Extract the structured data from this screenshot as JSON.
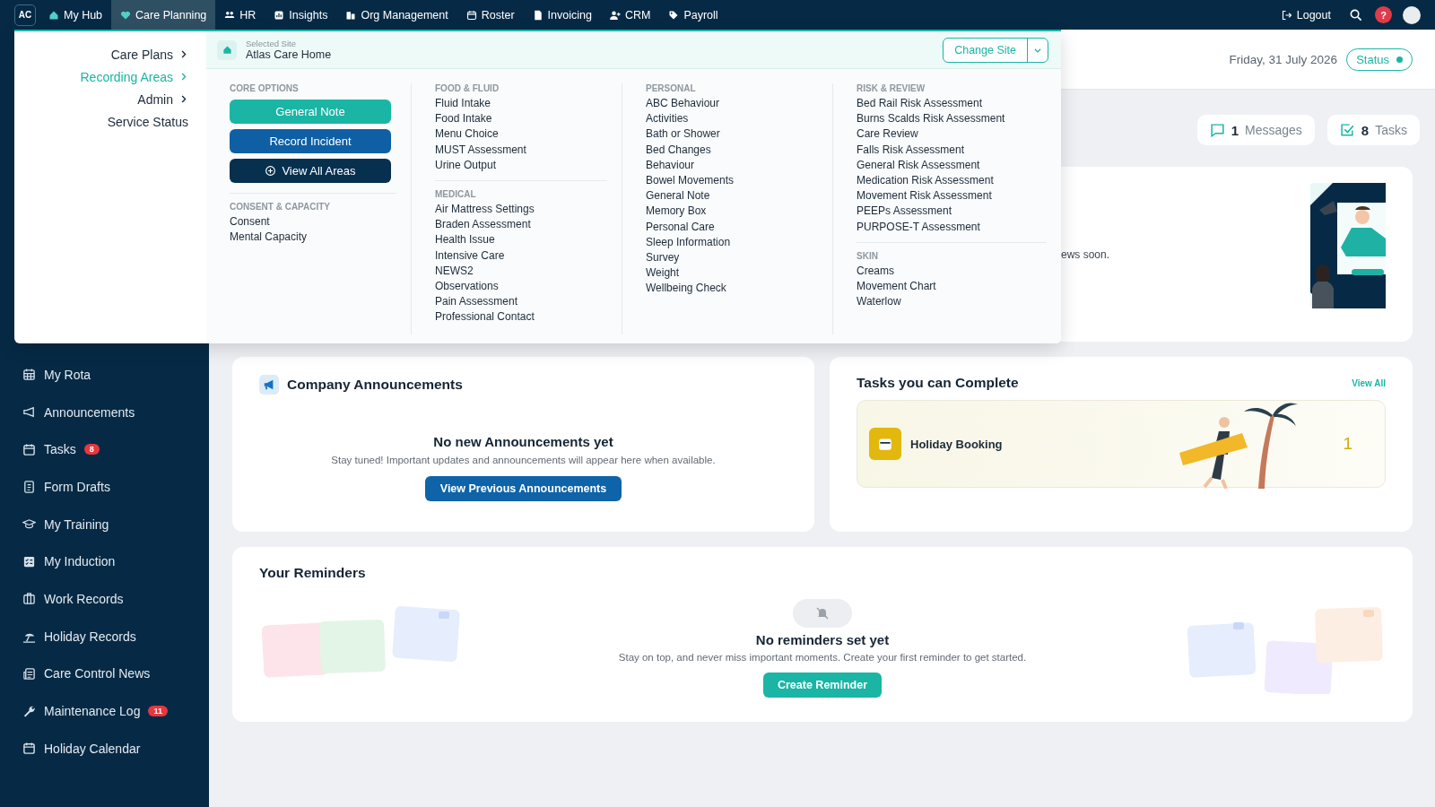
{
  "topbar": {
    "logo": "AC",
    "nav": [
      {
        "label": "My Hub",
        "selected": false
      },
      {
        "label": "Care Planning",
        "selected": true
      },
      {
        "label": "HR",
        "selected": false
      },
      {
        "label": "Insights",
        "selected": false
      },
      {
        "label": "Org Management",
        "selected": false
      },
      {
        "label": "Roster",
        "selected": false
      },
      {
        "label": "Invoicing",
        "selected": false
      },
      {
        "label": "CRM",
        "selected": false
      },
      {
        "label": "Payroll",
        "selected": false
      }
    ],
    "logout": "Logout",
    "help": "?"
  },
  "header": {
    "date": "Friday, 31 July 2026",
    "status": "Status"
  },
  "summary": [
    {
      "count": "1",
      "label": "Messages"
    },
    {
      "count": "8",
      "label": "Tasks"
    }
  ],
  "news_card": {
    "text": "ews soon."
  },
  "sidebar": {
    "items": [
      {
        "label": "My Rota"
      },
      {
        "label": "Announcements"
      },
      {
        "label": "Tasks",
        "badge": "8"
      },
      {
        "label": "Form Drafts"
      },
      {
        "label": "My Training"
      },
      {
        "label": "My Induction"
      },
      {
        "label": "Work Records"
      },
      {
        "label": "Holiday Records"
      },
      {
        "label": "Care Control News"
      },
      {
        "label": "Maintenance Log",
        "badge": "11"
      },
      {
        "label": "Holiday Calendar"
      }
    ]
  },
  "menu": {
    "categories": [
      {
        "label": "Care Plans",
        "selected": false,
        "submenu": true
      },
      {
        "label": "Recording Areas",
        "selected": true,
        "submenu": true
      },
      {
        "label": "Admin",
        "selected": false,
        "submenu": true
      },
      {
        "label": "Service Status",
        "selected": false,
        "submenu": false
      }
    ],
    "site": {
      "caption": "Selected Site",
      "name": "Atlas Care Home"
    },
    "change_site": "Change Site",
    "columns": [
      [
        {
          "heading": "CORE OPTIONS",
          "kind": "buttons",
          "buttons": [
            {
              "label": "General Note",
              "kind": "primary"
            },
            {
              "label": "Record Incident",
              "kind": "secondary"
            },
            {
              "label": "View All Areas",
              "kind": "all"
            }
          ]
        },
        {
          "heading": "CONSENT & CAPACITY",
          "kind": "links",
          "items": [
            "Consent",
            "Mental Capacity"
          ]
        }
      ],
      [
        {
          "heading": "FOOD & FLUID",
          "kind": "links",
          "items": [
            "Fluid Intake",
            "Food Intake",
            "Menu Choice",
            "MUST Assessment",
            "Urine Output"
          ]
        },
        {
          "heading": "MEDICAL",
          "kind": "links",
          "items": [
            "Air Mattress Settings",
            "Braden Assessment",
            "Health Issue",
            "Intensive Care",
            "NEWS2",
            "Observations",
            "Pain Assessment",
            "Professional Contact"
          ]
        }
      ],
      [
        {
          "heading": "PERSONAL",
          "kind": "links",
          "items": [
            "ABC Behaviour",
            "Activities",
            "Bath or Shower",
            "Bed Changes",
            "Behaviour",
            "Bowel Movements",
            "General Note",
            "Memory Box",
            "Personal Care",
            "Sleep Information",
            "Survey",
            "Weight",
            "Wellbeing Check"
          ]
        }
      ],
      [
        {
          "heading": "RISK & REVIEW",
          "kind": "links",
          "items": [
            "Bed Rail Risk Assessment",
            "Burns Scalds Risk Assessment",
            "Care Review",
            "Falls Risk Assessment",
            "General Risk Assessment",
            "Medication Risk Assessment",
            "Movement Risk Assessment",
            "PEEPs Assessment",
            "PURPOSE-T Assessment"
          ]
        },
        {
          "heading": "SKIN",
          "kind": "links",
          "items": [
            "Creams",
            "Movement Chart",
            "Waterlow"
          ]
        }
      ]
    ]
  },
  "announcements": {
    "title": "Company Announcements",
    "empty_title": "No new Announcements yet",
    "empty_text": "Stay tuned! Important updates and announcements will appear here when available.",
    "button": "View Previous Announcements"
  },
  "tasks": {
    "title": "Tasks you can Complete",
    "view_all": "View All",
    "items": [
      {
        "label": "Holiday Booking",
        "count": "1"
      }
    ]
  },
  "reminders": {
    "title": "Your Reminders",
    "empty_title": "No reminders set yet",
    "empty_text": "Stay on top, and never miss important moments. Create your first reminder to get started.",
    "button": "Create Reminder"
  }
}
